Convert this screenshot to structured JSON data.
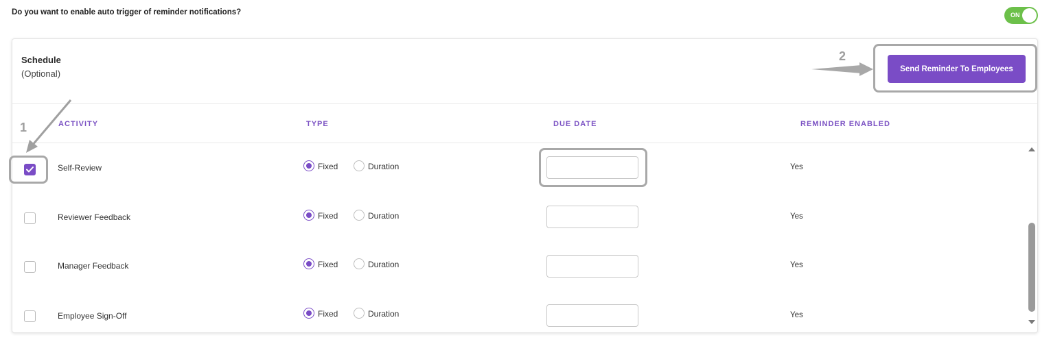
{
  "settings": {
    "question": "Do you want to enable auto trigger of reminder notifications?",
    "toggle_label": "ON",
    "toggle_color": "#6cc04a"
  },
  "schedule": {
    "title": "Schedule",
    "subtitle": "(Optional)",
    "send_button_label": "Send Reminder To Employees",
    "accent_color": "#7a4cc6"
  },
  "table": {
    "headers": [
      "ACTIVITY",
      "TYPE",
      "DUE DATE",
      "REMINDER ENABLED"
    ],
    "rows": [
      {
        "activity": "Self-Review",
        "checked": true,
        "type_options": [
          "Fixed",
          "Duration"
        ],
        "selected_type": "Fixed",
        "due_date": "",
        "reminder_enabled": "Yes"
      },
      {
        "activity": "Reviewer Feedback",
        "checked": false,
        "type_options": [
          "Fixed",
          "Duration"
        ],
        "selected_type": "Fixed",
        "due_date": "",
        "reminder_enabled": "Yes"
      },
      {
        "activity": "Manager Feedback",
        "checked": false,
        "type_options": [
          "Fixed",
          "Duration"
        ],
        "selected_type": "Fixed",
        "due_date": "",
        "reminder_enabled": "Yes"
      },
      {
        "activity": "Employee Sign-Off",
        "checked": false,
        "type_options": [
          "Fixed",
          "Duration"
        ],
        "selected_type": "Fixed",
        "due_date": "",
        "reminder_enabled": "Yes"
      }
    ]
  },
  "annotations": {
    "callout_1": "1",
    "callout_2": "2"
  }
}
